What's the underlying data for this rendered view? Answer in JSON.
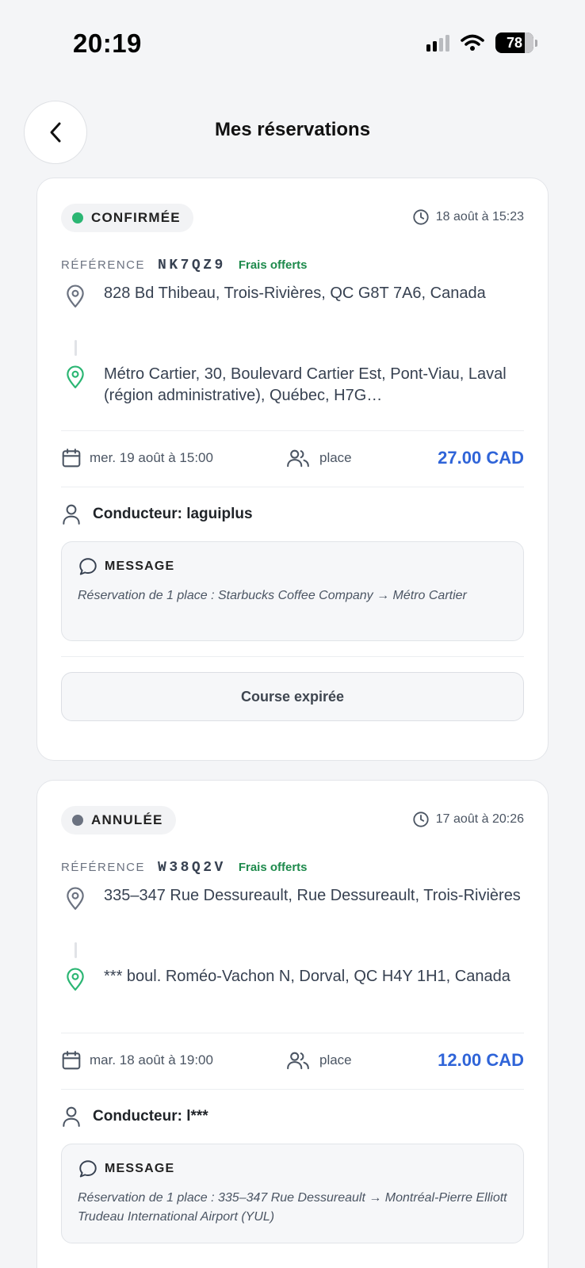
{
  "status_bar": {
    "time": "20:19",
    "battery": "78",
    "battery_level": 0.78
  },
  "header": {
    "title": "Mes réservations"
  },
  "reservations": [
    {
      "status": "CONFIRMÉE",
      "status_color": "#2bb673",
      "booked_at": "18 août à 15:23",
      "reference_label": "RÉFÉRENCE",
      "reference": "NK7QZ9",
      "fees_badge": "Frais offerts",
      "origin": "828 Bd Thibeau, Trois-Rivières, QC G8T 7A6, Canada",
      "destination": "Métro Cartier, 30, Boulevard Cartier Est, Pont-Viau, Laval (région administrative), Québec, H7G…",
      "departure": "mer. 19 août à 15:00",
      "seats_label": "place",
      "price": "27.00 CAD",
      "driver": "Conducteur: laguiplus",
      "message_label": "MESSAGE",
      "message": "Réservation de 1 place : Starbucks Coffee Company → Métro Cartier",
      "action": "Course expirée"
    },
    {
      "status": "ANNULÉE",
      "status_color": "#6b7280",
      "booked_at": "17 août à 20:26",
      "reference_label": "RÉFÉRENCE",
      "reference": "W38Q2V",
      "fees_badge": "Frais offerts",
      "origin": "335–347 Rue Dessureault, Rue Dessureault, Trois-Rivières",
      "destination": "*** boul. Roméo-Vachon N, Dorval, QC H4Y 1H1, Canada",
      "departure": "mar. 18 août à 19:00",
      "seats_label": "place",
      "price": "12.00 CAD",
      "driver": "Conducteur: l***",
      "message_label": "MESSAGE",
      "message": "Réservation de 1 place : 335–347 Rue Dessureault → Montréal-Pierre Elliott Trudeau International Airport (YUL)"
    }
  ],
  "colors": {
    "accent_price": "#2f64d8",
    "fees_green": "#1e8a4c",
    "destination_pin": "#2bb673"
  },
  "icons": {
    "back": "chevron-left-icon",
    "booked_at": "clock-icon",
    "origin": "map-pin-icon",
    "destination": "map-pin-icon",
    "departure": "calendar-icon",
    "seats": "users-icon",
    "driver": "user-icon",
    "message": "chat-bubble-icon"
  }
}
